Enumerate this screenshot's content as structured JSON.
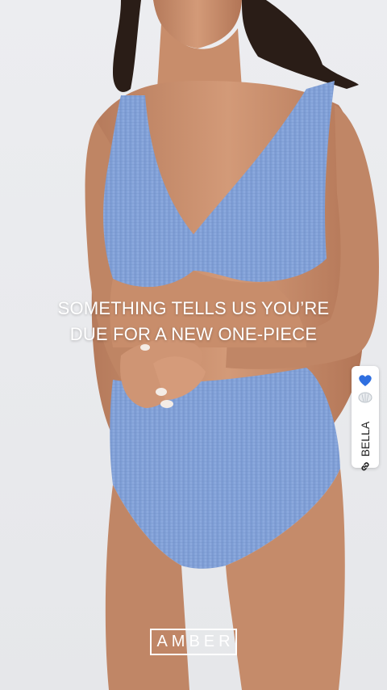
{
  "headline": {
    "line1": "SOMETHING TELLS US YOU’RE",
    "line2": "DUE FOR A NEW ONE-PIECE"
  },
  "product_tag": {
    "label": "BELLA",
    "icons": [
      "blue-heart-icon",
      "shell-icon",
      "link-icon"
    ]
  },
  "brand": {
    "logo_text": "AMBER"
  },
  "colors": {
    "swimsuit": "#86a6db",
    "skin": "#c98e6d",
    "hair": "#2a1d17",
    "background": "#e9e9ec",
    "heart": "#2f6fe0"
  }
}
